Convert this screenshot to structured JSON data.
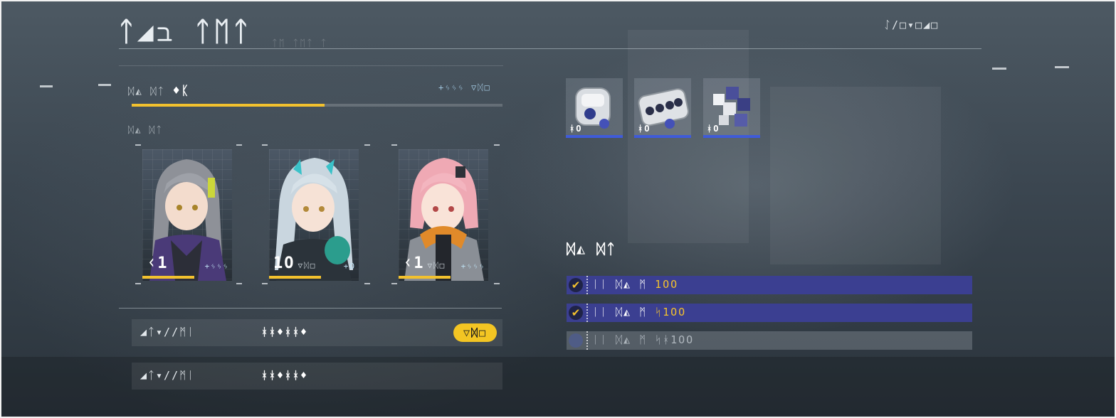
{
  "header": {
    "title": "ᛏ◢ℶ ᛏᛖᛏ",
    "title_echo": "ᛏᛖ ᛏᛖᛏ ᛏ",
    "top_right": "ᛇ/□▾□◢□"
  },
  "training": {
    "label": "ᛞ◭ ᛞᛏ",
    "label_accent": "♦ᛕ",
    "right_text": "+ᛃᛃᛃ ▽ᛞ□",
    "progress": 0.52,
    "squad_label": "ᛞ◭ ᛞᛏ"
  },
  "characters": [
    {
      "name": "grey-hair-doll",
      "level": "ᚲ1",
      "level_sub": "",
      "exp": "+ᛃᛃᛃ",
      "exp_progress": 0.58
    },
    {
      "name": "silver-hair-doll",
      "level": "1O",
      "level_sub": "▽ᛞ□",
      "exp": "+O",
      "exp_progress": 0.58
    },
    {
      "name": "pink-hair-doll",
      "level": "ᚲ1",
      "level_sub": "▽ᛞ□",
      "exp": "+ᛃᛃᛃ",
      "exp_progress": 0.58
    }
  ],
  "stats": [
    {
      "label": "◢ᛏ▾//ᛗᛁ",
      "value": "ᚼᚼ♦ᚼᚼ♦",
      "badge": "▽ᛞ□"
    },
    {
      "label": "◢ᛏ▾//ᛗᛁ",
      "value": "ᚼᚼ♦ᚼᚼ♦",
      "badge": ""
    }
  ],
  "items": [
    {
      "icon": "capsule-device-icon",
      "count": "ᚼO"
    },
    {
      "icon": "chip-tray-icon",
      "count": "ᚼO"
    },
    {
      "icon": "data-cubes-icon",
      "count": "ᚼO"
    }
  ],
  "rewards": {
    "title": "ᛞ◭ ᛞᛏ",
    "list": [
      {
        "label": "ᛁᛁ ᛞ◭ ᛗ ",
        "target": "1OO",
        "done": true
      },
      {
        "label": "ᛁᛁ ᛞ◭ ᛗ ",
        "target": "ᛋ1OO",
        "done": true
      },
      {
        "label": "ᛁᛁ ᛞ◭ ᛗ ",
        "target": "ᛋᚼ1OO",
        "done": false
      }
    ]
  },
  "colors": {
    "accent_yellow": "#f2c12e",
    "reward_done_bg": "#3b3f91",
    "item_bar_blue": "#3f5bd9"
  }
}
